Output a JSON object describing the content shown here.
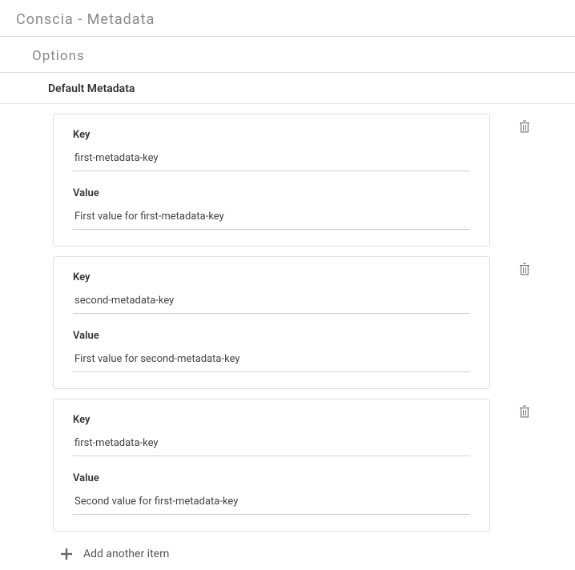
{
  "pageTitle": "Conscia - Metadata",
  "sectionTitle": "Options",
  "subsectionTitle": "Default Metadata",
  "labels": {
    "key": "Key",
    "value": "Value",
    "addItem": "Add another item"
  },
  "items": [
    {
      "key": "first-metadata-key",
      "value": "First value for first-metadata-key"
    },
    {
      "key": "second-metadata-key",
      "value": "First value for second-metadata-key"
    },
    {
      "key": "first-metadata-key",
      "value": "Second value for first-metadata-key"
    }
  ]
}
